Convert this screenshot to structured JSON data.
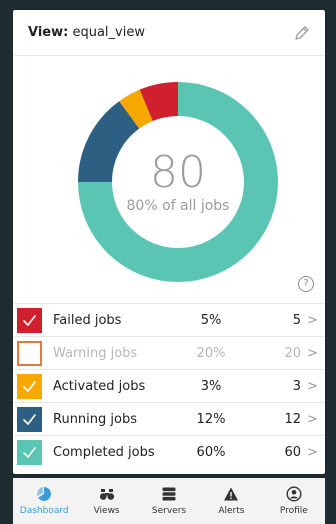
{
  "header": {
    "view_label": "View:",
    "view_name": "equal_view",
    "edit_icon": "pencil-icon"
  },
  "summary": {
    "value": "80",
    "caption": "80% of all jobs",
    "help_symbol": "?"
  },
  "chart_data": {
    "type": "pie",
    "style": "donut",
    "categories": [
      "Completed jobs",
      "Running jobs",
      "Activated jobs",
      "Failed jobs"
    ],
    "values": [
      60,
      12,
      3,
      5
    ],
    "colors": [
      "#5bc5b3",
      "#2d5f82",
      "#f7a800",
      "#d0202d"
    ]
  },
  "rows": [
    {
      "name": "Failed jobs",
      "pct": "5%",
      "count": "5",
      "chevron": ">",
      "color": "#d0202d",
      "icon": "check-icon",
      "muted": false
    },
    {
      "name": "Warning jobs",
      "pct": "20%",
      "count": "20",
      "chevron": ">",
      "color": "#e8773a",
      "icon": "empty-box-icon",
      "muted": true
    },
    {
      "name": "Activated jobs",
      "pct": "3%",
      "count": "3",
      "chevron": ">",
      "color": "#f7a800",
      "icon": "check-icon",
      "muted": false
    },
    {
      "name": "Running jobs",
      "pct": "12%",
      "count": "12",
      "chevron": ">",
      "color": "#2d5f82",
      "icon": "check-icon",
      "muted": false
    },
    {
      "name": "Completed jobs",
      "pct": "60%",
      "count": "60",
      "chevron": ">",
      "color": "#5bc5b3",
      "icon": "check-icon",
      "muted": false
    }
  ],
  "nav": [
    {
      "label": "Dashboard",
      "icon": "dashboard-pie-icon",
      "active": true
    },
    {
      "label": "Views",
      "icon": "binoculars-icon",
      "active": false
    },
    {
      "label": "Servers",
      "icon": "server-stack-icon",
      "active": false
    },
    {
      "label": "Alerts",
      "icon": "warning-triangle-icon",
      "active": false
    },
    {
      "label": "Profile",
      "icon": "user-circle-icon",
      "active": false
    }
  ],
  "colors": {
    "background": "#1f2d33",
    "accent": "#3c9bd6",
    "nav_bg": "#f3f3f3"
  }
}
